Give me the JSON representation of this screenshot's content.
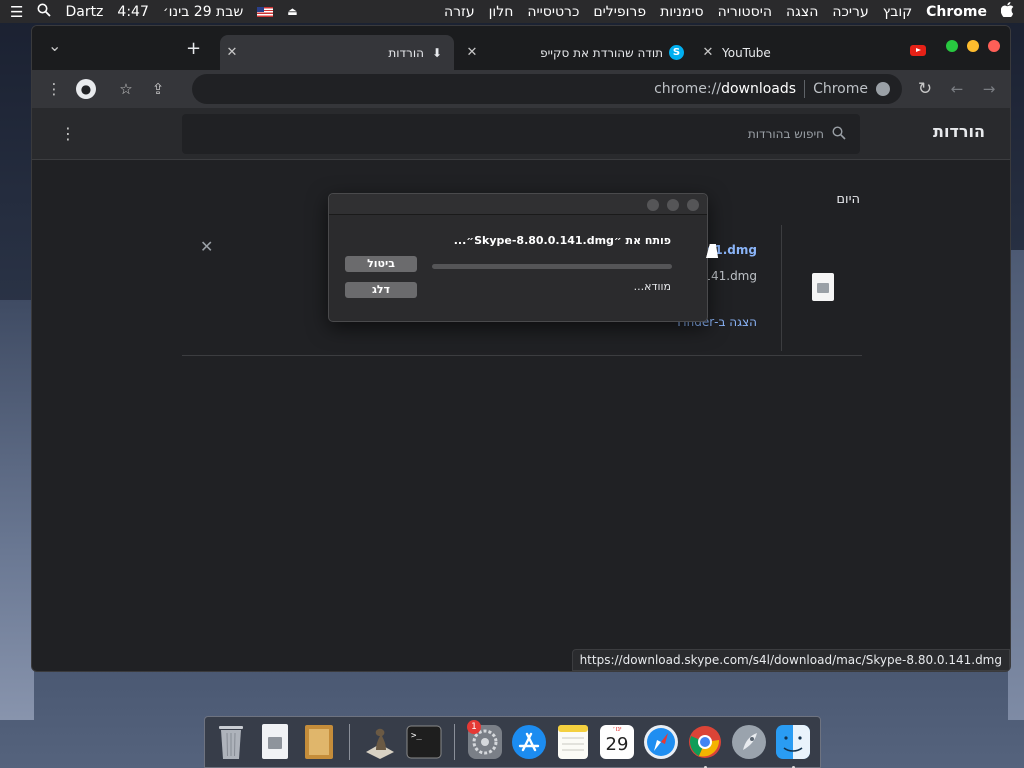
{
  "menubar": {
    "apple": "",
    "app_name": "Chrome",
    "menus": [
      "קובץ",
      "עריכה",
      "הצגה",
      "היסטוריה",
      "סימניות",
      "פרופילים",
      "כרטיסייה",
      "חלון",
      "עזרה"
    ],
    "date": "שבת 29 בינו׳",
    "time": "4:47",
    "user": "Dartz"
  },
  "tabs": [
    {
      "label": "YouTube",
      "icon": "youtube-icon"
    },
    {
      "label": "תודה שהורדת את סקייפ",
      "icon": "skype-icon"
    },
    {
      "label": "הורדות",
      "icon": "download-icon"
    }
  ],
  "new_tab": "+",
  "tab_close": "✕",
  "tab_menu": "⌄",
  "omnibox": {
    "scheme": "chrome://",
    "path": "downloads",
    "site_label": "Chrome"
  },
  "downloads": {
    "title": "הורדות",
    "search_placeholder": "חיפוש בהורדות",
    "day_label": "היום",
    "item": {
      "name_fragment": "41.dmg",
      "url_fragment": "141.dmg",
      "show_in_finder": "הצגה ב-Finder",
      "remove": "✕"
    },
    "status_url": "https://download.skype.com/s4l/download/mac/Skype-8.80.0.141.dmg"
  },
  "dialog": {
    "title": "פותח את ״Skype-8.80.0.141.dmg״...",
    "cancel_label": "ביטול",
    "skip_label": "דלג",
    "status": "מוודא..."
  },
  "dock": {
    "calendar_day": "29",
    "calendar_month": "ינו׳",
    "badge_count": "1"
  },
  "colors": {
    "accent": "#8ab4f8",
    "window_bg": "#202124",
    "toolbar": "#35363a"
  }
}
